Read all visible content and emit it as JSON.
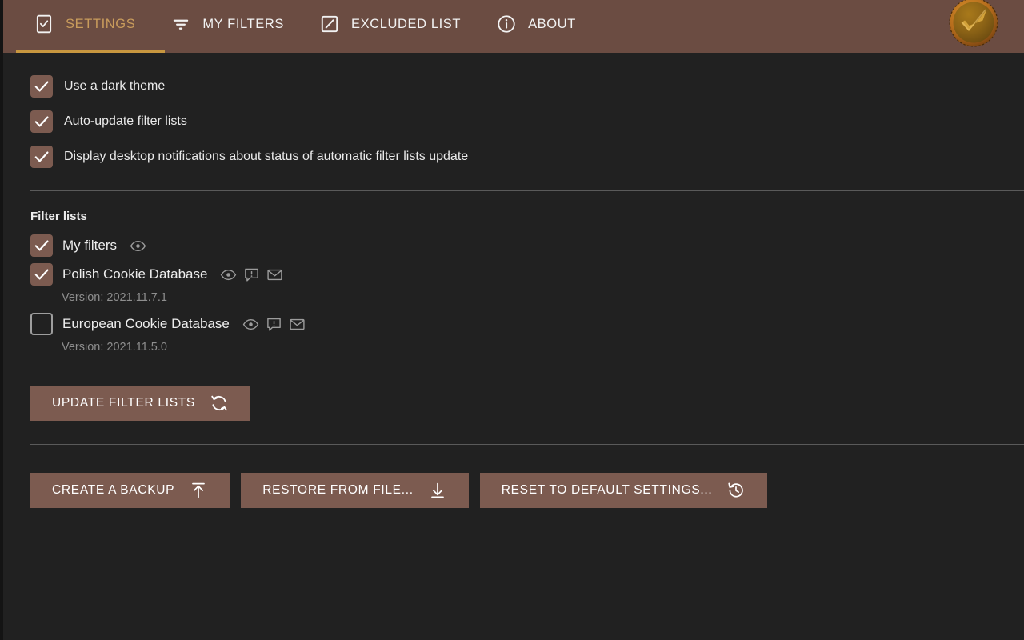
{
  "colors": {
    "header_bg": "#6B4C42",
    "page_bg": "#212121",
    "accent": "#C99C5C",
    "active_underline": "#C8973F",
    "control_fill": "#7C5B50",
    "text": "#eaeaea",
    "muted_text": "#8e8e8e"
  },
  "header": {
    "tabs": [
      {
        "label": "SETTINGS",
        "icon": "checkbox-square-icon",
        "active": true
      },
      {
        "label": "MY FILTERS",
        "icon": "filter-funnel-icon",
        "active": false
      },
      {
        "label": "EXCLUDED LIST",
        "icon": "square-slash-icon",
        "active": false
      },
      {
        "label": "ABOUT",
        "icon": "info-circle-icon",
        "active": false
      }
    ],
    "logo": {
      "name": "app-logo-coin-check",
      "alt": "Golden coin with checkmark"
    }
  },
  "options": [
    {
      "label": "Use a dark theme",
      "checked": true
    },
    {
      "label": "Auto-update filter lists",
      "checked": true
    },
    {
      "label": "Display desktop notifications about status of automatic filter lists update",
      "checked": true
    }
  ],
  "filter_lists": {
    "title": "Filter lists",
    "items": [
      {
        "name": "My filters",
        "checked": true,
        "version": "",
        "actions": [
          "eye-icon"
        ]
      },
      {
        "name": "Polish Cookie Database",
        "checked": true,
        "version": "Version: 2021.11.7.1",
        "actions": [
          "eye-icon",
          "report-issue-icon",
          "mail-icon"
        ]
      },
      {
        "name": "European Cookie Database",
        "checked": false,
        "version": "Version: 2021.11.5.0",
        "actions": [
          "eye-icon",
          "report-issue-icon",
          "mail-icon"
        ]
      }
    ],
    "update_button": {
      "label": "UPDATE FILTER LISTS",
      "icon": "refresh-icon"
    }
  },
  "bottom_actions": [
    {
      "label": "CREATE A BACKUP",
      "icon": "upload-icon"
    },
    {
      "label": "RESTORE FROM FILE...",
      "icon": "download-icon"
    },
    {
      "label": "RESET TO DEFAULT SETTINGS...",
      "icon": "history-restore-icon"
    }
  ]
}
